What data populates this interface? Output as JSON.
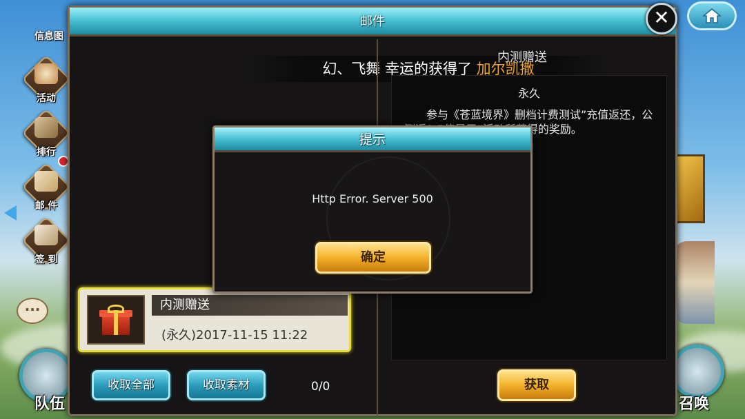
{
  "window": {
    "title": "邮件"
  },
  "notice": {
    "prefix": "幻、飞舞 幸运的获得了 ",
    "link": "加尔凯撒"
  },
  "detail": {
    "title": "内测赠送",
    "subtitle": "永久",
    "body": "参与《苍蓝境界》删档计费测试”充值返还，公测返1.5倍是于“活动所获得的奖励。"
  },
  "mail_list": [
    {
      "title": "内测赠送",
      "date": "(永久)2017-11-15  11:22",
      "icon": "gift-icon"
    }
  ],
  "buttons": {
    "collect_all": "收取全部",
    "collect_materials": "收取素材",
    "claim": "获取",
    "close": "✕"
  },
  "count": "0/0",
  "dialog": {
    "title": "提示",
    "message": "Http Error. Server 500",
    "confirm": "确定"
  },
  "sidebar": [
    {
      "label": "信息图",
      "icon": "info-icon"
    },
    {
      "label": "活动",
      "icon": "event-icon"
    },
    {
      "label": "排行",
      "icon": "ranking-icon"
    },
    {
      "label": "邮 件",
      "icon": "mail-icon"
    },
    {
      "label": "签 到",
      "icon": "checkin-icon"
    }
  ],
  "bottom": {
    "left_label": "队伍",
    "right_label": "召唤"
  },
  "colors": {
    "accent_cyan": "#4cc3d6",
    "accent_gold": "#f3b12a",
    "highlight": "#e8db3a",
    "link": "#f2a21e"
  }
}
